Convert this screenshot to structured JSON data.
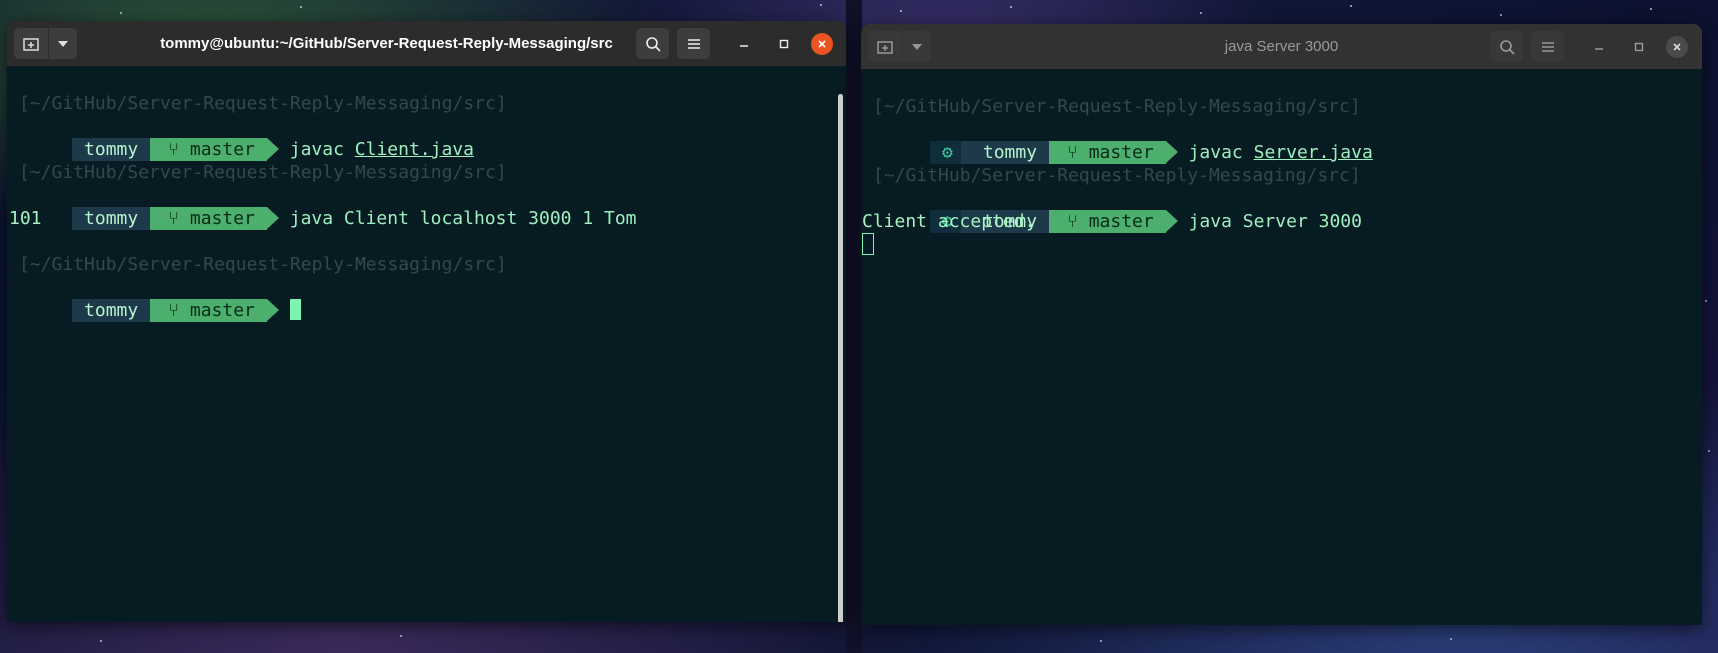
{
  "left_window": {
    "title": "tommy@ubuntu:~/GitHub/Server-Request-Reply-Messaging/src",
    "icons": {
      "new_tab": "new-tab-icon",
      "dropdown": "chevron-down-icon",
      "search": "search-icon",
      "menu": "hamburger-menu-icon",
      "minimize": "minimize-icon",
      "maximize": "maximize-icon",
      "close": "close-icon"
    },
    "lines": [
      {
        "path": "[~/GitHub/Server-Request-Reply-Messaging/src]",
        "user": "tommy",
        "branch": "master",
        "cmd": "javac",
        "arg": "Client.java"
      },
      {
        "path": "[~/GitHub/Server-Request-Reply-Messaging/src]",
        "user": "tommy",
        "branch": "master",
        "cmd": "java Client localhost 3000 1 Tom",
        "arg": ""
      },
      {
        "path": "[~/GitHub/Server-Request-Reply-Messaging/src]",
        "user": "tommy",
        "branch": "master",
        "cmd": "",
        "arg": ""
      }
    ],
    "output": "101"
  },
  "right_window": {
    "title": "java Server 3000",
    "lines": [
      {
        "path": "[~/GitHub/Server-Request-Reply-Messaging/src]",
        "gear": "⚙",
        "user": "tommy",
        "branch": "master",
        "cmd": "javac",
        "arg": "Server.java"
      },
      {
        "path": "[~/GitHub/Server-Request-Reply-Messaging/src]",
        "gear": "⚙",
        "user": "tommy",
        "branch": "master",
        "cmd": "java Server 3000",
        "arg": ""
      }
    ],
    "output": "Client accepted."
  },
  "colors": {
    "terminal_bg": "#071b22",
    "prompt_user_bg": "#1e3a4a",
    "prompt_branch_bg": "#4caf6d",
    "text_green": "#a6f2c2",
    "close_active": "#e95420"
  }
}
